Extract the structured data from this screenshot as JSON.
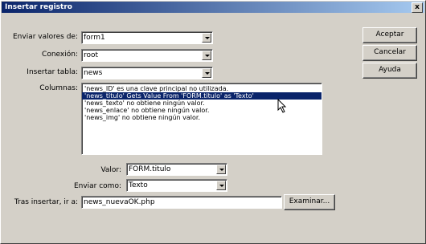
{
  "window": {
    "title": "Insertar registro",
    "close": "x"
  },
  "form": {
    "enviar_valores_label": "Enviar valores de:",
    "enviar_valores_value": "form1",
    "conexion_label": "Conexión:",
    "conexion_value": "root",
    "insertar_tabla_label": "Insertar tabla:",
    "insertar_tabla_value": "news",
    "columnas_label": "Columnas:",
    "columnas": [
      "'news_ID' es una clave principal no utilizada.",
      "'news_titulo' Gets Value From 'FORM.titulo' as 'Texto'",
      "'news_texto' no obtiene ningún valor.",
      "'news_enlace' no obtiene ningún valor.",
      "'news_img' no obtiene ningún valor."
    ],
    "selected_column_index": 1,
    "valor_label": "Valor:",
    "valor_value": "FORM.titulo",
    "enviar_como_label": "Enviar como:",
    "enviar_como_value": "Texto",
    "tras_insertar_label": "Tras insertar, ir a:",
    "tras_insertar_value": "news_nuevaOK.php",
    "examinar_label": "Examinar..."
  },
  "buttons": {
    "aceptar": "Aceptar",
    "cancelar": "Cancelar",
    "ayuda": "Ayuda"
  }
}
